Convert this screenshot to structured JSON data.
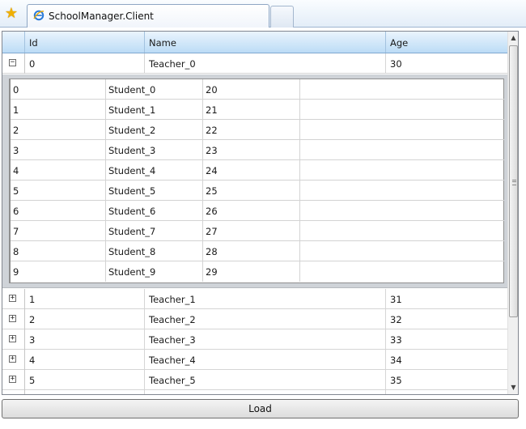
{
  "tab": {
    "title": "SchoolManager.Client",
    "favorites_icon": "star-icon",
    "page_icon": "ie-icon"
  },
  "grid": {
    "columns": [
      "Id",
      "Name",
      "Age"
    ],
    "expanded_row": {
      "id": "0",
      "name": "Teacher_0",
      "age": "30"
    },
    "students": [
      {
        "id": "0",
        "name": "Student_0",
        "age": "20"
      },
      {
        "id": "1",
        "name": "Student_1",
        "age": "21"
      },
      {
        "id": "2",
        "name": "Student_2",
        "age": "22"
      },
      {
        "id": "3",
        "name": "Student_3",
        "age": "23"
      },
      {
        "id": "4",
        "name": "Student_4",
        "age": "24"
      },
      {
        "id": "5",
        "name": "Student_5",
        "age": "25"
      },
      {
        "id": "6",
        "name": "Student_6",
        "age": "26"
      },
      {
        "id": "7",
        "name": "Student_7",
        "age": "27"
      },
      {
        "id": "8",
        "name": "Student_8",
        "age": "28"
      },
      {
        "id": "9",
        "name": "Student_9",
        "age": "29"
      }
    ],
    "teachers": [
      {
        "id": "1",
        "name": "Teacher_1",
        "age": "31"
      },
      {
        "id": "2",
        "name": "Teacher_2",
        "age": "32"
      },
      {
        "id": "3",
        "name": "Teacher_3",
        "age": "33"
      },
      {
        "id": "4",
        "name": "Teacher_4",
        "age": "34"
      },
      {
        "id": "5",
        "name": "Teacher_5",
        "age": "35"
      }
    ],
    "expand_glyph": "+",
    "collapse_glyph": "−"
  },
  "load_button": {
    "label": "Load"
  }
}
